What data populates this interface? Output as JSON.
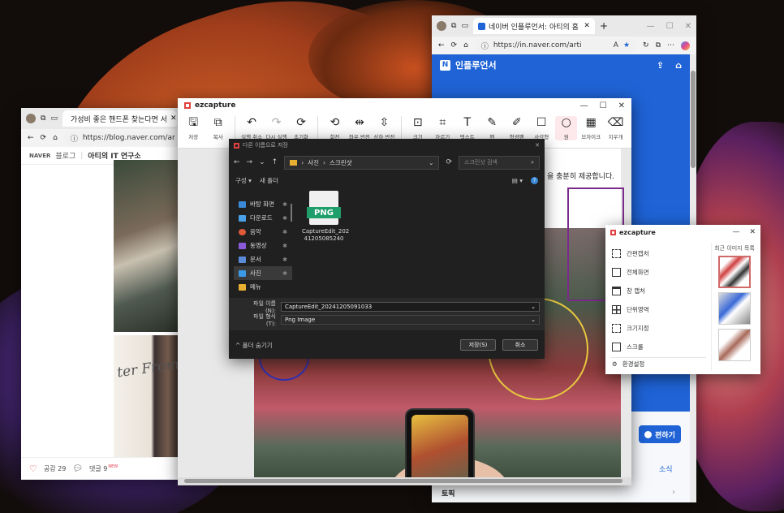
{
  "blog": {
    "tab_title": "가성비 좋은 핸드폰 찾는다면 서",
    "url": "https://blog.naver.com/artism",
    "brand": "NAVER",
    "brand_sub": "블로그",
    "blog_name": "아티의 IT 연구소",
    "photo_text": "ter From P",
    "like_label": "공감 29",
    "comment_label": "댓글 9",
    "new_badge": "NEW"
  },
  "naver": {
    "tab_title": "네이버 인플루언서: 아티의 홈",
    "url": "https://in.naver.com/arti",
    "logo_letter": "N",
    "title": "인플루언서",
    "edit_label": "편하기",
    "news_label": "소식",
    "topic_label": "토픽"
  },
  "editor": {
    "app_name": "ezcapture",
    "min": "—",
    "max": "☐",
    "close": "✕",
    "tools_left": [
      {
        "name": "save",
        "glyph": "🖫",
        "label": "저장"
      },
      {
        "name": "copy",
        "glyph": "⧉",
        "label": "복사"
      }
    ],
    "tools_mid": [
      {
        "name": "undo",
        "glyph": "↶",
        "label": "실행 취소"
      },
      {
        "name": "redo",
        "glyph": "↷",
        "label": "다시 실행"
      },
      {
        "name": "reset",
        "glyph": "⟳",
        "label": "초기화"
      }
    ],
    "tools_transform": [
      {
        "name": "rotate",
        "glyph": "⟲",
        "label": "회전"
      },
      {
        "name": "flip-h",
        "glyph": "⇹",
        "label": "좌우 반전"
      },
      {
        "name": "flip-v",
        "glyph": "⇳",
        "label": "상하 반전"
      }
    ],
    "tools_draw": [
      {
        "name": "resize",
        "glyph": "⊡",
        "label": "크기"
      },
      {
        "name": "crop",
        "glyph": "⌗",
        "label": "자르기"
      },
      {
        "name": "text",
        "glyph": "T",
        "label": "텍스트"
      },
      {
        "name": "pen",
        "glyph": "✎",
        "label": "펜"
      },
      {
        "name": "highlighter",
        "glyph": "✐",
        "label": "형광펜"
      },
      {
        "name": "rectangle",
        "glyph": "☐",
        "label": "사각형"
      },
      {
        "name": "ellipse",
        "glyph": "○",
        "label": "원"
      },
      {
        "name": "mosaic",
        "glyph": "▦",
        "label": "모자이크"
      },
      {
        "name": "eraser",
        "glyph": "⌫",
        "label": "지우개"
      }
    ],
    "caption_text": "을 충분히 제공합니다."
  },
  "dialog": {
    "title": "다른 이름으로 저장",
    "path_root": "사진",
    "path_leaf": "스크린샷",
    "search_placeholder": "스크린샷 검색",
    "organize_label": "구성 ▾",
    "new_folder_label": "새 폴더",
    "sidebar": [
      {
        "label": "바탕 화면",
        "color": "#3a8ad8"
      },
      {
        "label": "다운로드",
        "color": "#4aa0e8"
      },
      {
        "label": "음악",
        "color": "#e05a3a"
      },
      {
        "label": "동영상",
        "color": "#8a5ad8"
      },
      {
        "label": "문서",
        "color": "#5a8ad8"
      },
      {
        "label": "사진",
        "color": "#3a9ae8"
      },
      {
        "label": "메뉴",
        "color": "#e8b030"
      }
    ],
    "file_badge": "PNG",
    "file_name_line1": "CaptureEdit_202",
    "file_name_line2": "41205085240",
    "filename_label": "파일 이름(N):",
    "filename_value": "CaptureEdit_20241205091033",
    "filetype_label": "파일 형식(T):",
    "filetype_value": "Png Image",
    "hide_folders_label": "^ 폴더 숨기기",
    "save_button": "저장(S)",
    "cancel_button": "취소"
  },
  "mini": {
    "app_name": "ezcapture",
    "menu": [
      "간편캡처",
      "전체화면",
      "창 캡처",
      "단위영역",
      "크기지정",
      "스크롤"
    ],
    "settings": "환경설정",
    "recent_header": "최근 이미지 목록"
  }
}
